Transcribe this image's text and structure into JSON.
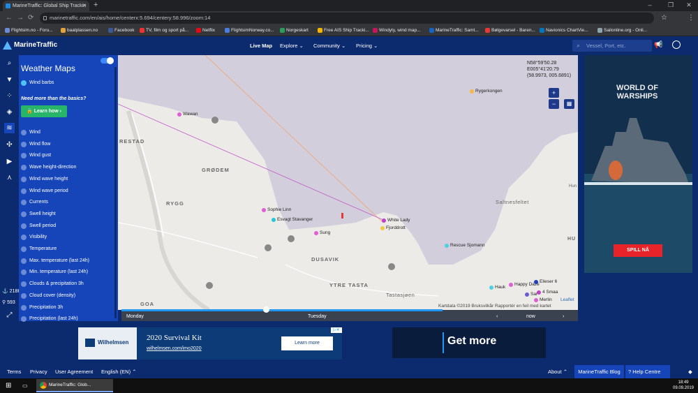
{
  "browser": {
    "tab_title": "MarineTraffic: Global Ship Trackin",
    "url": "marinetraffic.com/en/ais/home/centerx:5.694/centery:58.996/zoom:14",
    "bookmarks": [
      "Flightsim.no - Foru...",
      "baatplassen.no",
      "Facebook",
      "TV, film og sport på...",
      "Netflix",
      "FlightsimNorway.co...",
      "Norgeskart",
      "Free AIS Ship Tracki...",
      "Windyty, wind map...",
      "MarineTraffic: Samt...",
      "Bølgevarsel - Baren...",
      "Navionics ChartVie...",
      "Sailonline.org - Onli..."
    ]
  },
  "header": {
    "logo": "MarineTraffic",
    "menu": [
      "Live Map",
      "Explore",
      "Community",
      "Pricing"
    ],
    "search_placeholder": "Vessel, Port, etc."
  },
  "panel": {
    "title": "Weather Maps",
    "wind_barbs": "Wind barbs",
    "need_more": "Need more than the basics?",
    "learn_how": "Learn how",
    "layers": [
      "Wind",
      "Wind flow",
      "Wind gust",
      "Wave height-direction",
      "Wind wave height",
      "Wind wave period",
      "Currents",
      "Swell height",
      "Swell period",
      "Visibility",
      "Temperature",
      "Max. temperature (last 24h)",
      "Min. temperature (last 24h)",
      "Clouds & precipitation 3h",
      "Cloud cover (density)",
      "Precipitation 3h",
      "Precipitation (last 24h)"
    ]
  },
  "stats": {
    "a": "218K",
    "b": "593"
  },
  "map": {
    "coords": "N58°59'50.28\nE005°41'20.79\n(58.9973, 005.6891)",
    "places": [
      "RESTAD",
      "GRØDEM",
      "RYGG",
      "DUSAVIK",
      "YTRE TASTA",
      "Tastasjøen",
      "GOA",
      "Saltnesfeltet",
      "Hun",
      "HU"
    ],
    "vessels": [
      "Wawan",
      "Sophie Linn",
      "Esvagt Stavanger",
      "Sung",
      "White Lady",
      "Fjorddrott",
      "Rygerkongen",
      "Rescue Sjomann",
      "Hauk",
      "Happy Daze",
      "Elieser 6",
      "4 Smaa",
      "Merlin",
      "Sar"
    ],
    "attribution": "Kartdata ©2019   Bruksvilkår   Rapportér en feil med kartet",
    "leaflet": "Leaflet"
  },
  "timeline": {
    "day1": "Monday",
    "day2": "Tuesday",
    "now": "now"
  },
  "ads": {
    "right_title": "WORLD OF WARSHIPS",
    "right_button": "SPILL NÅ",
    "bottom_brand": "Wilhelmsen",
    "bottom_title": "2020 Survival Kit",
    "bottom_link": "wilhelmsen.com/imo2020",
    "bottom_button": "Learn more",
    "bottom2": "Get more"
  },
  "footer": {
    "links": [
      "Terms",
      "Privacy",
      "User Agreement",
      "English (EN)"
    ],
    "right": [
      "About",
      "MarineTraffic Blog",
      "Help Centre"
    ]
  },
  "taskbar": {
    "app": "MarineTraffic: Glob...",
    "time": "18:49",
    "date": "09.09.2019"
  }
}
